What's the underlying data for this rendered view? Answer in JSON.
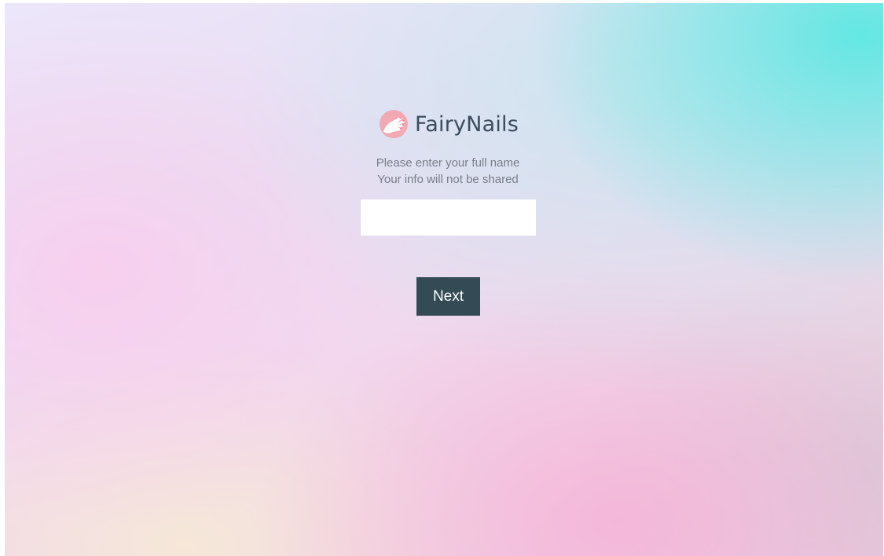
{
  "brand": {
    "name": "FairyNails",
    "logo_icon": "painted-nails-hand-icon",
    "logo_color": "#f2a7b0"
  },
  "form": {
    "instruction_line1": "Please enter your full name",
    "instruction_line2": "Your info will not be shared",
    "name_input": {
      "value": "",
      "placeholder": ""
    },
    "next_label": "Next"
  },
  "colors": {
    "button_bg": "#344a55",
    "title_text": "#3b4c5c",
    "subtitle_text": "#7a7f88",
    "background_accent_teal": "#5ce8e2",
    "background_accent_pink": "#f6b2d8"
  }
}
